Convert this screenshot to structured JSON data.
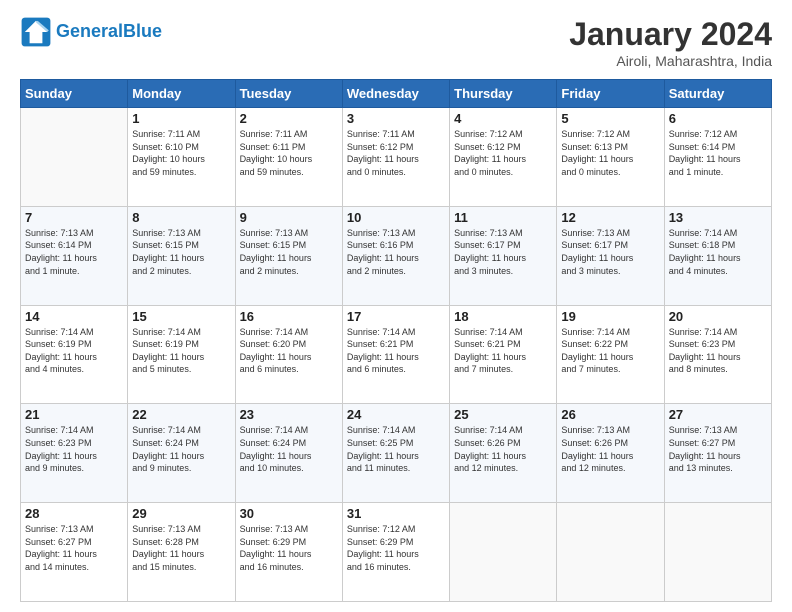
{
  "header": {
    "logo_text_general": "General",
    "logo_text_blue": "Blue",
    "month_year": "January 2024",
    "location": "Airoli, Maharashtra, India"
  },
  "weekdays": [
    "Sunday",
    "Monday",
    "Tuesday",
    "Wednesday",
    "Thursday",
    "Friday",
    "Saturday"
  ],
  "weeks": [
    [
      {
        "day": "",
        "info": ""
      },
      {
        "day": "1",
        "info": "Sunrise: 7:11 AM\nSunset: 6:10 PM\nDaylight: 10 hours\nand 59 minutes."
      },
      {
        "day": "2",
        "info": "Sunrise: 7:11 AM\nSunset: 6:11 PM\nDaylight: 10 hours\nand 59 minutes."
      },
      {
        "day": "3",
        "info": "Sunrise: 7:11 AM\nSunset: 6:12 PM\nDaylight: 11 hours\nand 0 minutes."
      },
      {
        "day": "4",
        "info": "Sunrise: 7:12 AM\nSunset: 6:12 PM\nDaylight: 11 hours\nand 0 minutes."
      },
      {
        "day": "5",
        "info": "Sunrise: 7:12 AM\nSunset: 6:13 PM\nDaylight: 11 hours\nand 0 minutes."
      },
      {
        "day": "6",
        "info": "Sunrise: 7:12 AM\nSunset: 6:14 PM\nDaylight: 11 hours\nand 1 minute."
      }
    ],
    [
      {
        "day": "7",
        "info": "Sunrise: 7:13 AM\nSunset: 6:14 PM\nDaylight: 11 hours\nand 1 minute."
      },
      {
        "day": "8",
        "info": "Sunrise: 7:13 AM\nSunset: 6:15 PM\nDaylight: 11 hours\nand 2 minutes."
      },
      {
        "day": "9",
        "info": "Sunrise: 7:13 AM\nSunset: 6:15 PM\nDaylight: 11 hours\nand 2 minutes."
      },
      {
        "day": "10",
        "info": "Sunrise: 7:13 AM\nSunset: 6:16 PM\nDaylight: 11 hours\nand 2 minutes."
      },
      {
        "day": "11",
        "info": "Sunrise: 7:13 AM\nSunset: 6:17 PM\nDaylight: 11 hours\nand 3 minutes."
      },
      {
        "day": "12",
        "info": "Sunrise: 7:13 AM\nSunset: 6:17 PM\nDaylight: 11 hours\nand 3 minutes."
      },
      {
        "day": "13",
        "info": "Sunrise: 7:14 AM\nSunset: 6:18 PM\nDaylight: 11 hours\nand 4 minutes."
      }
    ],
    [
      {
        "day": "14",
        "info": "Sunrise: 7:14 AM\nSunset: 6:19 PM\nDaylight: 11 hours\nand 4 minutes."
      },
      {
        "day": "15",
        "info": "Sunrise: 7:14 AM\nSunset: 6:19 PM\nDaylight: 11 hours\nand 5 minutes."
      },
      {
        "day": "16",
        "info": "Sunrise: 7:14 AM\nSunset: 6:20 PM\nDaylight: 11 hours\nand 6 minutes."
      },
      {
        "day": "17",
        "info": "Sunrise: 7:14 AM\nSunset: 6:21 PM\nDaylight: 11 hours\nand 6 minutes."
      },
      {
        "day": "18",
        "info": "Sunrise: 7:14 AM\nSunset: 6:21 PM\nDaylight: 11 hours\nand 7 minutes."
      },
      {
        "day": "19",
        "info": "Sunrise: 7:14 AM\nSunset: 6:22 PM\nDaylight: 11 hours\nand 7 minutes."
      },
      {
        "day": "20",
        "info": "Sunrise: 7:14 AM\nSunset: 6:23 PM\nDaylight: 11 hours\nand 8 minutes."
      }
    ],
    [
      {
        "day": "21",
        "info": "Sunrise: 7:14 AM\nSunset: 6:23 PM\nDaylight: 11 hours\nand 9 minutes."
      },
      {
        "day": "22",
        "info": "Sunrise: 7:14 AM\nSunset: 6:24 PM\nDaylight: 11 hours\nand 9 minutes."
      },
      {
        "day": "23",
        "info": "Sunrise: 7:14 AM\nSunset: 6:24 PM\nDaylight: 11 hours\nand 10 minutes."
      },
      {
        "day": "24",
        "info": "Sunrise: 7:14 AM\nSunset: 6:25 PM\nDaylight: 11 hours\nand 11 minutes."
      },
      {
        "day": "25",
        "info": "Sunrise: 7:14 AM\nSunset: 6:26 PM\nDaylight: 11 hours\nand 12 minutes."
      },
      {
        "day": "26",
        "info": "Sunrise: 7:13 AM\nSunset: 6:26 PM\nDaylight: 11 hours\nand 12 minutes."
      },
      {
        "day": "27",
        "info": "Sunrise: 7:13 AM\nSunset: 6:27 PM\nDaylight: 11 hours\nand 13 minutes."
      }
    ],
    [
      {
        "day": "28",
        "info": "Sunrise: 7:13 AM\nSunset: 6:27 PM\nDaylight: 11 hours\nand 14 minutes."
      },
      {
        "day": "29",
        "info": "Sunrise: 7:13 AM\nSunset: 6:28 PM\nDaylight: 11 hours\nand 15 minutes."
      },
      {
        "day": "30",
        "info": "Sunrise: 7:13 AM\nSunset: 6:29 PM\nDaylight: 11 hours\nand 16 minutes."
      },
      {
        "day": "31",
        "info": "Sunrise: 7:12 AM\nSunset: 6:29 PM\nDaylight: 11 hours\nand 16 minutes."
      },
      {
        "day": "",
        "info": ""
      },
      {
        "day": "",
        "info": ""
      },
      {
        "day": "",
        "info": ""
      }
    ]
  ]
}
